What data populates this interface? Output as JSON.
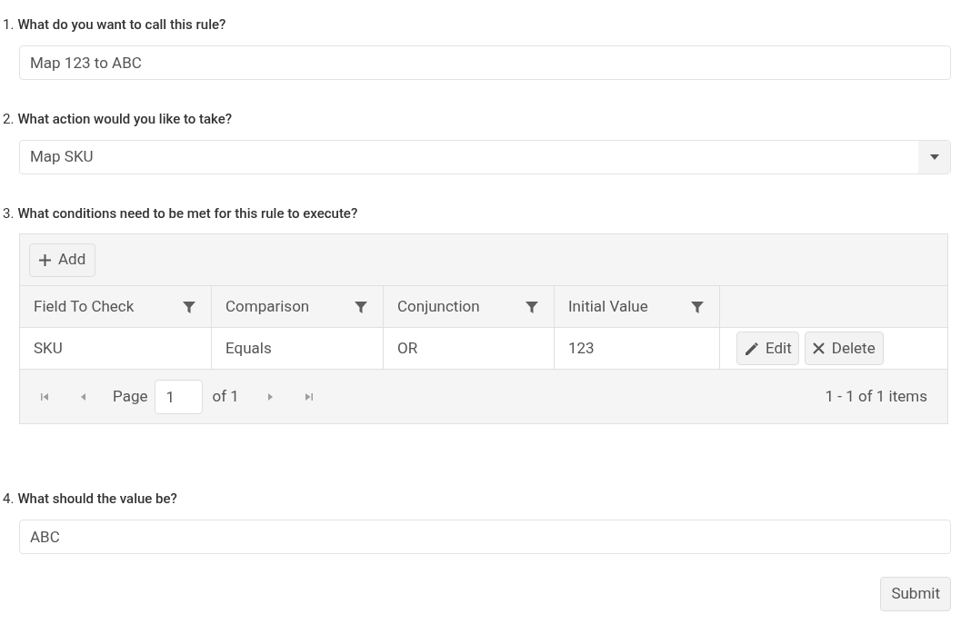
{
  "questions": [
    {
      "number": "1.",
      "label": "What do you want to call this rule?",
      "kind": "text",
      "value": "Map 123 to ABC"
    },
    {
      "number": "2.",
      "label": "What action would you like to take?",
      "kind": "select",
      "value": "Map SKU"
    },
    {
      "number": "3.",
      "label": "What conditions need to be met for this rule to execute?",
      "kind": "grid"
    },
    {
      "number": "4.",
      "label": "What should the value be?",
      "kind": "text",
      "value": "ABC"
    }
  ],
  "grid": {
    "toolbar": {
      "add_button": "Add"
    },
    "columns": [
      "Field To Check",
      "Comparison",
      "Conjunction",
      "Initial Value"
    ],
    "rows": [
      {
        "cells": [
          "SKU",
          "Equals",
          "OR",
          "123"
        ],
        "edit_button": "Edit",
        "delete_button": "Delete"
      }
    ],
    "pager": {
      "page_label": "Page",
      "page_value": "1",
      "of_label": "of 1",
      "summary": "1 - 1 of 1 items"
    }
  },
  "submit_button": "Submit"
}
